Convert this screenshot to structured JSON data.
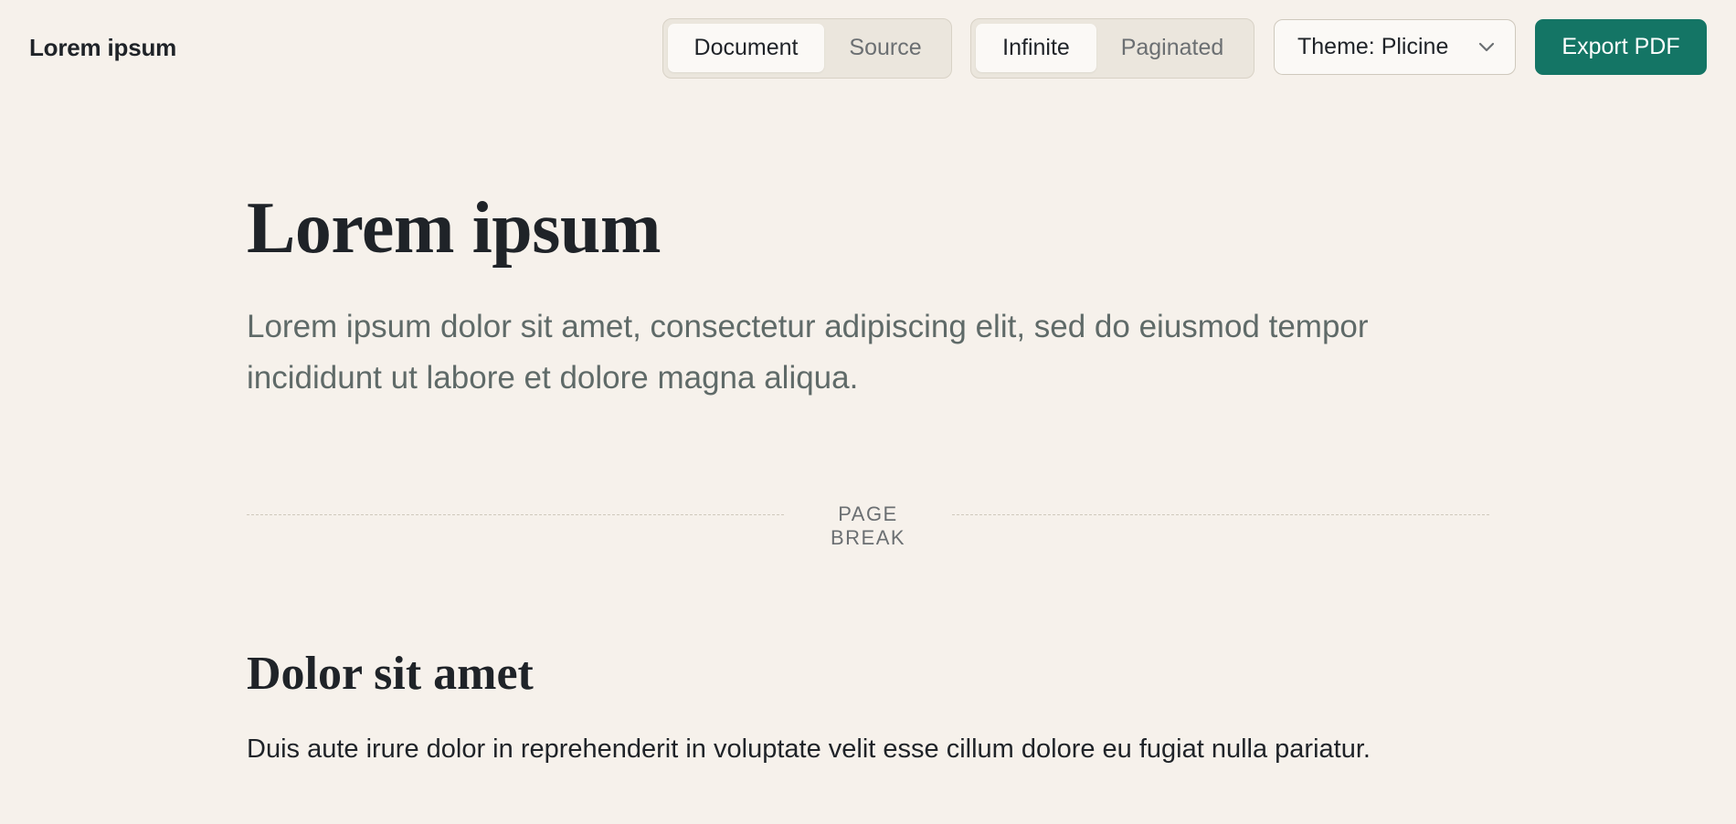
{
  "header": {
    "app_title": "Lorem ipsum",
    "view_toggle": {
      "options": [
        "Document",
        "Source"
      ],
      "selected": "Document"
    },
    "layout_toggle": {
      "options": [
        "Infinite",
        "Paginated"
      ],
      "selected": "Infinite"
    },
    "theme_select": {
      "label": "Theme: Plicine"
    },
    "export_button": "Export PDF",
    "colors": {
      "accent": "#147565",
      "background": "#f6f1eb"
    }
  },
  "document": {
    "title": "Lorem ipsum",
    "subtitle": "Lorem ipsum dolor sit amet, consectetur adipiscing elit, sed do eiusmod tempor incididunt ut labore et dolore magna aliqua.",
    "page_break_label": "PAGE BREAK",
    "sections": [
      {
        "heading": "Dolor sit amet",
        "body": "Duis aute irure dolor in reprehenderit in voluptate velit esse cillum dolore eu fugiat nulla pariatur."
      }
    ]
  }
}
